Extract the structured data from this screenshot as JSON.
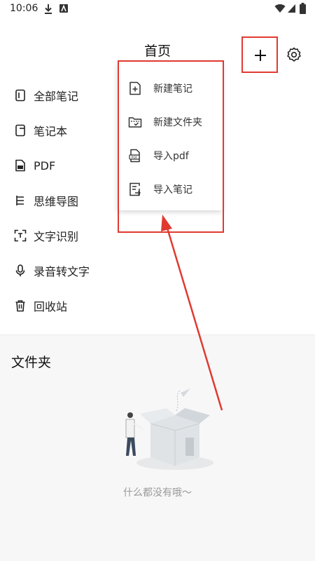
{
  "status_bar": {
    "time": "10:06",
    "icons": [
      "download-icon",
      "app-notification-icon",
      "wifi-icon",
      "signal-icon",
      "battery-icon"
    ]
  },
  "header": {
    "title": "首页",
    "add_icon": "plus-icon",
    "settings_icon": "gear-icon"
  },
  "sidebar": {
    "items": [
      {
        "label": "全部笔记",
        "icon": "all-notes-icon"
      },
      {
        "label": "笔记本",
        "icon": "notebook-icon"
      },
      {
        "label": "PDF",
        "icon": "pdf-icon"
      },
      {
        "label": "思维导图",
        "icon": "mind-map-icon"
      },
      {
        "label": "文字识别",
        "icon": "text-scan-icon"
      },
      {
        "label": "录音转文字",
        "icon": "microphone-icon"
      },
      {
        "label": "回收站",
        "icon": "trash-icon"
      }
    ]
  },
  "dropdown": {
    "items": [
      {
        "label": "新建笔记",
        "icon": "new-note-icon"
      },
      {
        "label": "新建文件夹",
        "icon": "new-folder-icon"
      },
      {
        "label": "导入pdf",
        "icon": "import-pdf-icon"
      },
      {
        "label": "导入笔记",
        "icon": "import-note-icon"
      }
    ]
  },
  "folders": {
    "title": "文件夹",
    "empty_text": "什么都没有哦～"
  },
  "colors": {
    "highlight": "#e03a30",
    "background": "#ffffff",
    "empty_background": "#f7f7f8"
  }
}
